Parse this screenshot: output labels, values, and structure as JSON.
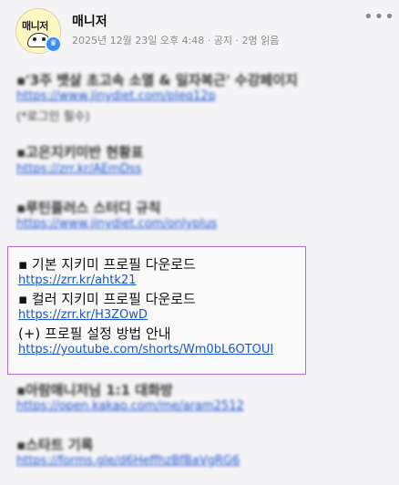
{
  "post": {
    "avatar_text": "매니저",
    "author": "매니저",
    "meta": "2025년 12월 23일 오후 4:48 · 공지 · 2명 읽음"
  },
  "blurred": [
    {
      "type": "bullet",
      "text": "▪'3주 뱃살 초고속 소멸 & 일자복근' 수강페이지"
    },
    {
      "type": "link",
      "text": "https://www.jinydiet.com/pleq12p"
    },
    {
      "type": "plain",
      "text": "(*로그인 필수)"
    },
    {
      "type": "bullet",
      "text": "▪고은지키미반 현황표"
    },
    {
      "type": "link",
      "text": "https://zrr.kr/AEmDss"
    },
    {
      "type": "bullet",
      "text": "▪루틴플러스 스터디 규칙"
    },
    {
      "type": "link",
      "text": "https://www.jinydiet.com/onlyplus"
    },
    {
      "type": "bullet",
      "text": "▪아람매니저님 1:1 대화방"
    },
    {
      "type": "link",
      "text": "https://open.kakao.com/me/aram2512"
    },
    {
      "type": "bullet",
      "text": "▪스타트 기록"
    },
    {
      "type": "link",
      "text": "https://forms.gle/d6HeffhzBfBaVgRG6"
    }
  ],
  "highlight": {
    "item1_title": "▪ 기본 지키미 프로필 다운로드",
    "item1_link": "https://zrr.kr/ahtk21",
    "item2_title": "▪ 컬러 지키미 프로필 다운로드",
    "item2_link": "https://zrr.kr/H3ZOwD",
    "item3_title": "(+) 프로필 설정 방법 안내",
    "item3_link": "https://youtube.com/shorts/Wm0bL6OTOUI"
  }
}
